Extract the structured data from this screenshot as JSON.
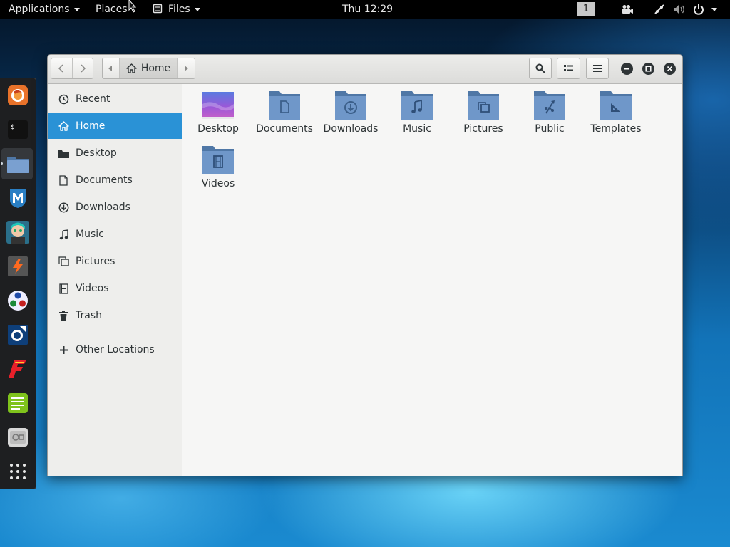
{
  "topbar": {
    "applications": "Applications",
    "places": "Places",
    "files": "Files",
    "clock": "Thu 12:29",
    "workspace": "1"
  },
  "dock": {
    "apps": [
      {
        "name": "firefox-icon"
      },
      {
        "name": "terminal-icon"
      },
      {
        "name": "files-icon"
      },
      {
        "name": "metasploit-icon"
      },
      {
        "name": "armitage-icon"
      },
      {
        "name": "burpsuite-icon"
      },
      {
        "name": "maltego-icon"
      },
      {
        "name": "beef-icon"
      },
      {
        "name": "faraday-icon"
      },
      {
        "name": "leafpad-icon"
      },
      {
        "name": "screenshot-icon"
      },
      {
        "name": "show-applications-icon"
      }
    ]
  },
  "window": {
    "path_label": "Home",
    "sidebar": {
      "items": [
        {
          "label": "Recent",
          "icon": "clock-icon"
        },
        {
          "label": "Home",
          "icon": "home-icon",
          "active": true
        },
        {
          "label": "Desktop",
          "icon": "desktop-icon"
        },
        {
          "label": "Documents",
          "icon": "document-icon"
        },
        {
          "label": "Downloads",
          "icon": "download-icon"
        },
        {
          "label": "Music",
          "icon": "music-icon"
        },
        {
          "label": "Pictures",
          "icon": "pictures-icon"
        },
        {
          "label": "Videos",
          "icon": "video-icon"
        },
        {
          "label": "Trash",
          "icon": "trash-icon"
        }
      ],
      "other_locations": "Other Locations"
    },
    "folders": [
      {
        "label": "Desktop"
      },
      {
        "label": "Documents"
      },
      {
        "label": "Downloads"
      },
      {
        "label": "Music"
      },
      {
        "label": "Pictures"
      },
      {
        "label": "Public"
      },
      {
        "label": "Templates"
      },
      {
        "label": "Videos"
      }
    ]
  },
  "colors": {
    "accent": "#2a92d6",
    "folder": "#6f97c9",
    "folder_tab": "#4f77a6"
  }
}
